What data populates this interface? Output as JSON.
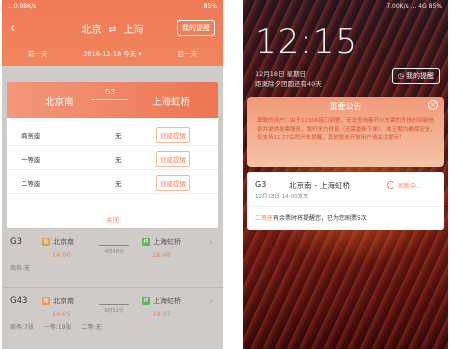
{
  "left": {
    "status": {
      "time": "...0.08K/s",
      "right": "85%"
    },
    "header": {
      "back": "‹",
      "from": "北京",
      "arrows": "⇄",
      "to": "上海",
      "remind_button": "我的提醒"
    },
    "datebar": {
      "prev": "前一天",
      "date": "2016-12-18 今天 ▾",
      "next": "后一天"
    },
    "sheet": {
      "from": "北京南",
      "train": "G3",
      "to": "上海虹桥",
      "rows": [
        {
          "name": "商务座",
          "avail": "无",
          "button": "创建提醒"
        },
        {
          "name": "一等座",
          "avail": "无",
          "button": "创建提醒"
        },
        {
          "name": "二等座",
          "avail": "无",
          "button": "创建提醒"
        }
      ],
      "close": "关闭"
    },
    "trains": [
      {
        "no": "G3",
        "from_tag": "始",
        "from": "北京南",
        "to_tag": "终",
        "to": "上海虹桥",
        "dep": "14:00",
        "dur": "4时48分",
        "arr": "18:48",
        "seats": [
          "商务:无",
          "",
          ""
        ]
      },
      {
        "no": "G43",
        "from_tag": "始",
        "from": "北京南",
        "to_tag": "终",
        "to": "上海虹桥",
        "dep": "14:05",
        "dur": "5时32分",
        "arr": "19:37",
        "seats": [
          "商务:7张",
          "一等:19张",
          "二等:无"
        ]
      }
    ]
  },
  "right": {
    "status": {
      "right": "7.00K/s  ...  4G  85%"
    },
    "clock": "12:15",
    "date": "12月18日  星期日",
    "days": "距离除夕团圆还有40天",
    "remind_button": "我的提醒",
    "notice": {
      "title": "重要公告",
      "close": "×",
      "body": "尊敬的用户：由于12306接口调整，无法查询春节火车票的开抢时间新信息并提供抢票服务，我们全力修复（无需重新下单）。本王期为确保安全，仅支持11.17后的开车提醒，其他暂未开放用户请关注提示！"
    },
    "card": {
      "no": "G3",
      "route": "北京南 – 上海虹桥",
      "sub": "12月18日   14:00发车",
      "status": "刷新中...",
      "msg_highlight": "二等座",
      "msg_rest": "有余票时将提醒您，已为您刷票5次"
    }
  }
}
